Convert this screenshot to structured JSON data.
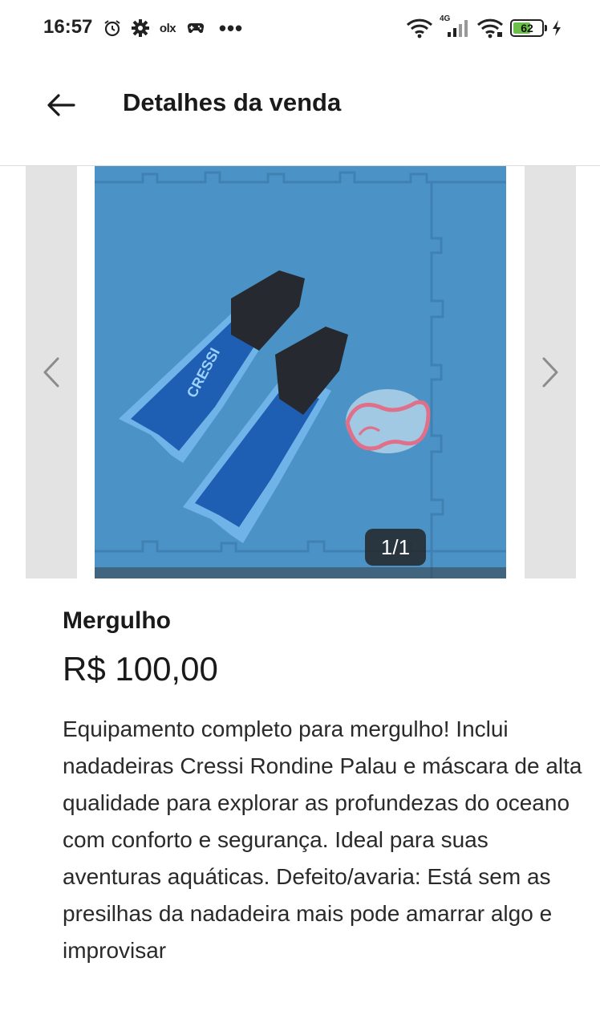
{
  "status_bar": {
    "time": "16:57",
    "olx_label": "olx",
    "network_label": "4G",
    "battery_percent": 62,
    "battery_text": "62",
    "icons": [
      "alarm-icon",
      "gear-icon",
      "gamepad-icon",
      "more-icon",
      "wifi-icon",
      "signal-icon",
      "wifi-calling-icon",
      "battery-icon",
      "charging-icon"
    ]
  },
  "header": {
    "title": "Detalhes da venda",
    "back_icon": "arrow-left-icon"
  },
  "gallery": {
    "counter": "1/1",
    "prev_icon": "chevron-left-icon",
    "next_icon": "chevron-right-icon",
    "brand_text": "CRESSI"
  },
  "listing": {
    "title": "Mergulho",
    "price": "R$ 100,00",
    "description": "Equipamento completo para mergulho! Inclui nadadeiras Cressi Rondine Palau e máscara de alta qualidade para explorar as profundezas do oceano com conforto e segurança. Ideal para suas aventuras aquáticas. Defeito/avaria: Está sem as presilhas da nadadeira mais pode amarrar algo e improvisar"
  },
  "colors": {
    "mat_blue": "#4b93c6",
    "fin_blue": "#1f5fb3",
    "battery_green": "#6cc04a",
    "mask_pink": "#e0708a"
  }
}
